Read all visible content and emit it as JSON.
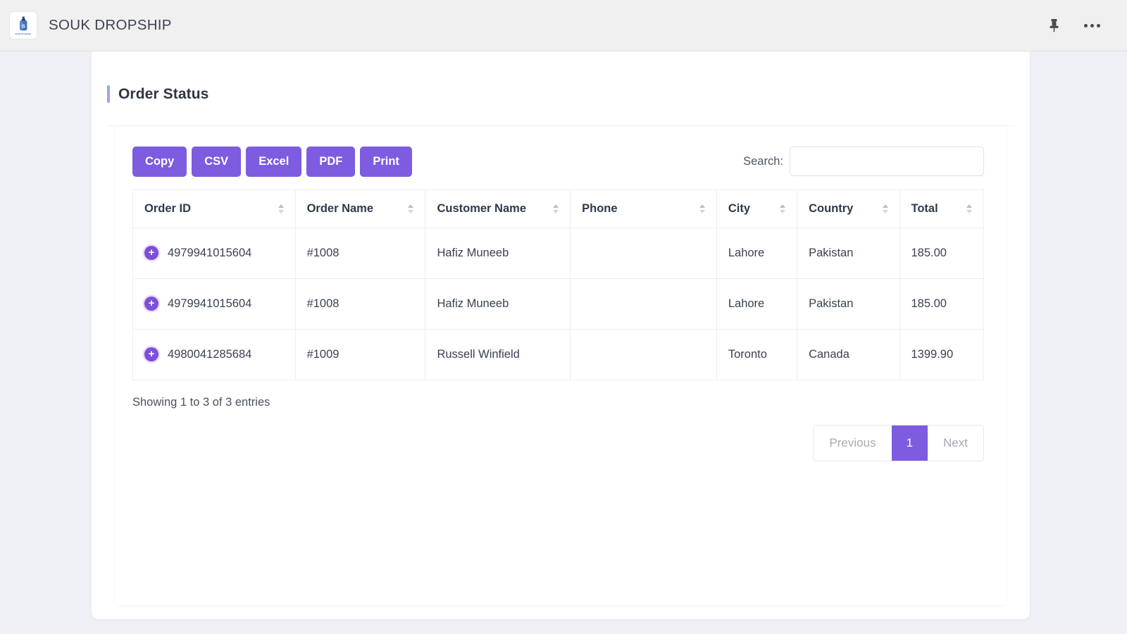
{
  "appbar": {
    "title": "SOUK DROPSHIP",
    "logo_caption": "Souk Dropship",
    "logo_icon": "perfume-bottle-icon",
    "pin_icon": "pin-icon",
    "more_icon": "ellipsis-icon"
  },
  "panel": {
    "title": "Order Status",
    "accent_start": "#7fb2f0",
    "accent_end": "#b79ae8"
  },
  "toolbar": {
    "export_buttons": [
      {
        "label": "Copy",
        "name": "copy-button"
      },
      {
        "label": "CSV",
        "name": "csv-button"
      },
      {
        "label": "Excel",
        "name": "excel-button"
      },
      {
        "label": "PDF",
        "name": "pdf-button"
      },
      {
        "label": "Print",
        "name": "print-button"
      }
    ],
    "accent_color": "#7d5ce0"
  },
  "search": {
    "label": "Search:",
    "value": "",
    "placeholder": ""
  },
  "table": {
    "columns": [
      {
        "label": "Order ID",
        "sortable": true
      },
      {
        "label": "Order Name",
        "sortable": true
      },
      {
        "label": "Customer Name",
        "sortable": true
      },
      {
        "label": "Phone",
        "sortable": true
      },
      {
        "label": "City",
        "sortable": true
      },
      {
        "label": "Country",
        "sortable": true
      },
      {
        "label": "Total",
        "sortable": true
      }
    ],
    "rows": [
      {
        "expand": "+",
        "order_id": "4979941015604",
        "order_name": "#1008",
        "customer_name": "Hafiz Muneeb",
        "phone": "",
        "city": "Lahore",
        "country": "Pakistan",
        "total": "185.00"
      },
      {
        "expand": "+",
        "order_id": "4979941015604",
        "order_name": "#1008",
        "customer_name": "Hafiz Muneeb",
        "phone": "",
        "city": "Lahore",
        "country": "Pakistan",
        "total": "185.00"
      },
      {
        "expand": "+",
        "order_id": "4980041285684",
        "order_name": "#1009",
        "customer_name": "Russell Winfield",
        "phone": "",
        "city": "Toronto",
        "country": "Canada",
        "total": "1399.90"
      }
    ]
  },
  "footer": {
    "showing": "Showing 1 to 3 of 3 entries",
    "pagination": {
      "previous": "Previous",
      "pages": [
        "1"
      ],
      "active_page": "1",
      "next": "Next"
    }
  }
}
